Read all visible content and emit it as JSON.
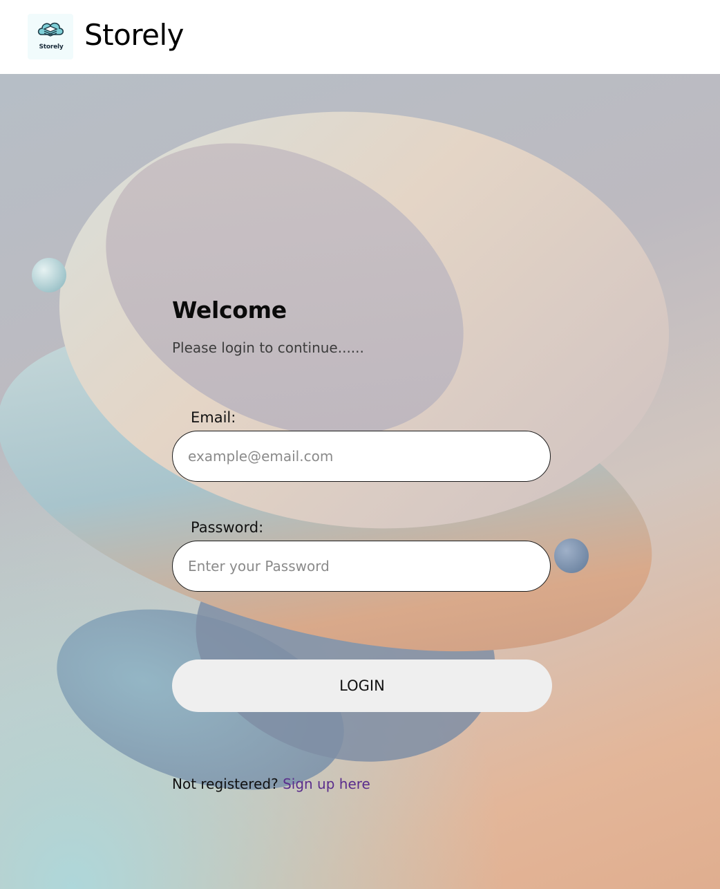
{
  "header": {
    "logo_text": "Storely",
    "brand_name": "Storely"
  },
  "login": {
    "title": "Welcome",
    "subtitle": "Please login to continue......",
    "email_label": "Email:",
    "email_placeholder": "example@email.com",
    "email_value": "",
    "password_label": "Password:",
    "password_placeholder": "Enter your Password",
    "password_value": "",
    "login_button": "LOGIN",
    "signup_prompt": "Not registered?",
    "signup_link": "Sign up here"
  },
  "icons": {
    "logo": "cloud-layers-icon"
  },
  "colors": {
    "link": "#5a2d8c",
    "button_bg": "#efefef",
    "logo_accent": "#5fb8c2"
  }
}
